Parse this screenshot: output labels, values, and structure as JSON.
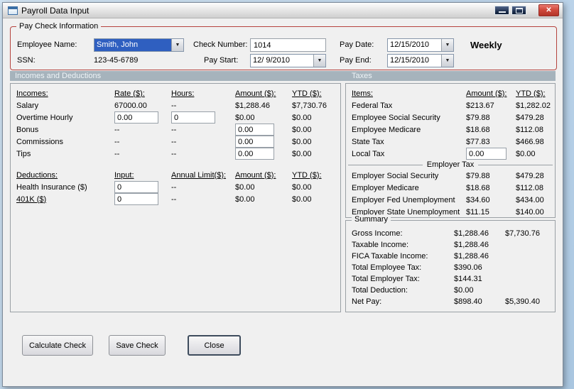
{
  "window": {
    "title": "Payroll Data Input"
  },
  "icons": {
    "close": "✕",
    "dropdown": "▼"
  },
  "colors": {
    "group_border": "#b5433e",
    "section_header_bg": "#a6b3bc",
    "selection_bg": "#2f5fc0",
    "close_button_red": "#d14a3d"
  },
  "paycheck": {
    "group_label": "Pay Check Information",
    "fields": {
      "employee_name": {
        "label": "Employee Name:",
        "value": "Smith, John"
      },
      "ssn": {
        "label": "SSN:",
        "value": "123-45-6789"
      },
      "check_number": {
        "label": "Check Number:",
        "value": "1014"
      },
      "pay_start": {
        "label": "Pay Start:",
        "value": "12/ 9/2010"
      },
      "pay_date": {
        "label": "Pay Date:",
        "value": "12/15/2010"
      },
      "pay_end": {
        "label": "Pay End:",
        "value": "12/15/2010"
      }
    },
    "frequency": "Weekly"
  },
  "sections": {
    "left": "Incomes and Deductions",
    "right": "Taxes"
  },
  "incomes": {
    "headers": {
      "item": "Incomes:",
      "rate": "Rate ($):",
      "hours": "Hours:",
      "amount": "Amount ($):",
      "ytd": "YTD ($):"
    },
    "rows": [
      {
        "label": "Salary",
        "rate": "67000.00",
        "hours": "--",
        "amount": "$1,288.46",
        "ytd": "$7,730.76"
      },
      {
        "label": "Overtime Hourly",
        "rate": "0.00",
        "hours": "0",
        "amount": "$0.00",
        "ytd": "$0.00"
      },
      {
        "label": "Bonus",
        "rate": "--",
        "hours": "--",
        "amount": "0.00",
        "ytd": "$0.00"
      },
      {
        "label": "Commissions",
        "rate": "--",
        "hours": "--",
        "amount": "0.00",
        "ytd": "$0.00"
      },
      {
        "label": "Tips",
        "rate": "--",
        "hours": "--",
        "amount": "0.00",
        "ytd": "$0.00"
      }
    ]
  },
  "deductions": {
    "headers": {
      "item": "Deductions:",
      "input": "Input:",
      "limit": "Annual Limit($):",
      "amount": "Amount ($):",
      "ytd": "YTD ($):"
    },
    "rows": [
      {
        "label": "Health Insurance  ($)",
        "input": "0",
        "limit": "--",
        "amount": "$0.00",
        "ytd": "$0.00"
      },
      {
        "label": "401K  ($)",
        "input": "0",
        "limit": "--",
        "amount": "$0.00",
        "ytd": "$0.00"
      }
    ]
  },
  "taxes": {
    "headers": {
      "item": "Items:",
      "amount": "Amount ($):",
      "ytd": "YTD ($):"
    },
    "employee_rows": [
      {
        "label": "Federal Tax",
        "amount": "$213.67",
        "ytd": "$1,282.02"
      },
      {
        "label": "Employee Social Security",
        "amount": "$79.88",
        "ytd": "$479.28"
      },
      {
        "label": "Employee Medicare",
        "amount": "$18.68",
        "ytd": "$112.08"
      },
      {
        "label": "State Tax",
        "amount": "$77.83",
        "ytd": "$466.98"
      },
      {
        "label": "Local Tax",
        "amount": "0.00",
        "ytd": "$0.00"
      }
    ],
    "employer_header": "Employer Tax",
    "employer_rows": [
      {
        "label": "Employer Social Security",
        "amount": "$79.88",
        "ytd": "$479.28"
      },
      {
        "label": "Employer Medicare",
        "amount": "$18.68",
        "ytd": "$112.08"
      },
      {
        "label": "Employer Fed Unemployment",
        "amount": "$34.60",
        "ytd": "$434.00"
      },
      {
        "label": "Employer State Unemployment",
        "amount": "$11.15",
        "ytd": "$140.00"
      }
    ]
  },
  "summary": {
    "group_label": "Summary",
    "rows": [
      {
        "label": "Gross Income:",
        "amount": "$1,288.46",
        "ytd": "$7,730.76"
      },
      {
        "label": "Taxable Income:",
        "amount": "$1,288.46",
        "ytd": ""
      },
      {
        "label": "FICA Taxable Income:",
        "amount": "$1,288.46",
        "ytd": ""
      },
      {
        "label": "Total Employee Tax:",
        "amount": "$390.06",
        "ytd": ""
      },
      {
        "label": "Total Employer Tax:",
        "amount": "$144.31",
        "ytd": ""
      },
      {
        "label": "Total Deduction:",
        "amount": "$0.00",
        "ytd": ""
      },
      {
        "label": "Net Pay:",
        "amount": "$898.40",
        "ytd": "$5,390.40"
      }
    ]
  },
  "footer": {
    "calculate_label": "Calculate Check",
    "save_label": "Save Check",
    "close_label": "Close"
  }
}
